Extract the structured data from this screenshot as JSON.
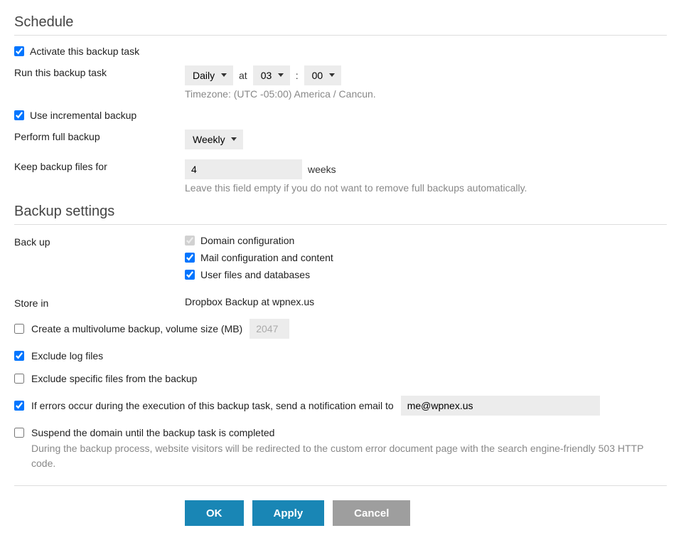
{
  "schedule": {
    "title": "Schedule",
    "activate_label": "Activate this backup task",
    "activate_checked": true,
    "run_label": "Run this backup task",
    "frequency": "Daily",
    "at_label": "at",
    "hour": "03",
    "colon": ":",
    "minute": "00",
    "timezone_note": "Timezone: (UTC -05:00) America / Cancun.",
    "incremental_label": "Use incremental backup",
    "incremental_checked": true,
    "full_backup_label": "Perform full backup",
    "full_backup_frequency": "Weekly",
    "keep_label": "Keep backup files for",
    "keep_value": "4",
    "keep_unit": "weeks",
    "keep_note": "Leave this field empty if you do not want to remove full backups automatically."
  },
  "backup_settings": {
    "title": "Backup settings",
    "backup_label": "Back up",
    "options": {
      "domain_config": {
        "label": "Domain configuration",
        "checked": true
      },
      "mail_config": {
        "label": "Mail configuration and content",
        "checked": true
      },
      "user_files": {
        "label": "User files and databases",
        "checked": true
      }
    },
    "store_label": "Store in",
    "store_value": "Dropbox Backup at wpnex.us",
    "multivolume": {
      "label": "Create a multivolume backup, volume size (MB)",
      "checked": false,
      "value": "2047"
    },
    "exclude_log": {
      "label": "Exclude log files",
      "checked": true
    },
    "exclude_specific": {
      "label": "Exclude specific files from the backup",
      "checked": false
    },
    "notify_errors": {
      "label": "If errors occur during the execution of this backup task, send a notification email to",
      "checked": true,
      "email": "me@wpnex.us"
    },
    "suspend": {
      "label": "Suspend the domain until the backup task is completed",
      "checked": false,
      "help": "During the backup process, website visitors will be redirected to the custom error document page with the search engine-friendly 503 HTTP code."
    }
  },
  "buttons": {
    "ok": "OK",
    "apply": "Apply",
    "cancel": "Cancel"
  }
}
